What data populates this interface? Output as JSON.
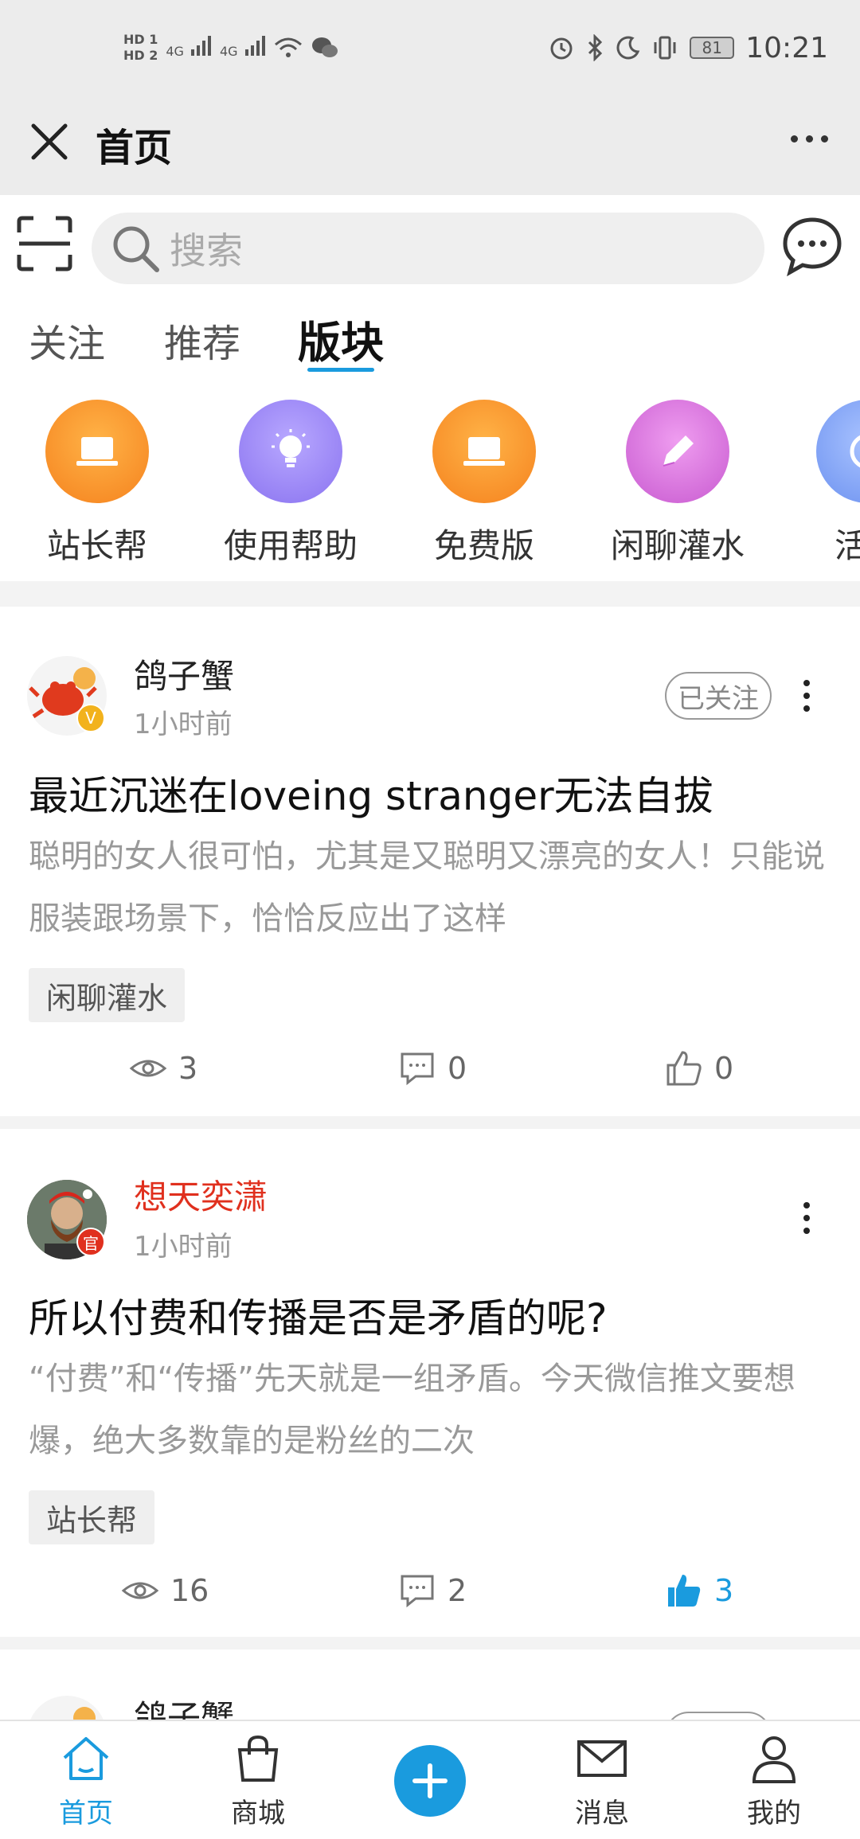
{
  "status": {
    "time": "10:21",
    "battery": "81",
    "network_left": [
      "HD 1",
      "HD 2",
      "4G",
      "4G"
    ]
  },
  "titlebar": {
    "title": "首页"
  },
  "search": {
    "placeholder": "搜索"
  },
  "tabs": [
    {
      "label": "关注"
    },
    {
      "label": "推荐"
    },
    {
      "label": "版块",
      "active": true
    }
  ],
  "categories": [
    {
      "label": "站长帮",
      "color": "#f5921e",
      "icon": "laptop-icon"
    },
    {
      "label": "使用帮助",
      "color": "#9b8cf0",
      "icon": "lightbulb-icon"
    },
    {
      "label": "免费版",
      "color": "#f5921e",
      "icon": "laptop-icon"
    },
    {
      "label": "闲聊灌水",
      "color": "#d76ad8",
      "icon": "pencil-icon"
    },
    {
      "label": "活动",
      "color": "#7aa0f5",
      "icon": "clock-icon"
    }
  ],
  "posts": [
    {
      "author": "鸽子蟹",
      "author_color": "#222222",
      "time": "1小时前",
      "follow": "已关注",
      "title": "最近沉迷在loveing stranger无法自拔",
      "excerpt": "聪明的女人很可怕，尤其是又聪明又漂亮的女人！只能说服装跟场景下，恰恰反应出了这样",
      "tag": "闲聊灌水",
      "views": "3",
      "comments": "0",
      "likes": "0",
      "liked": false,
      "badge": "V"
    },
    {
      "author": "想天奕潇",
      "author_color": "#e0301e",
      "time": "1小时前",
      "follow": "",
      "title": "所以付费和传播是否是矛盾的呢?",
      "excerpt": "“付费”和“传播”先天就是一组矛盾。今天微信推文要想爆，绝大多数靠的是粉丝的二次",
      "tag": "站长帮",
      "views": "16",
      "comments": "2",
      "likes": "3",
      "liked": true,
      "badge": "官"
    },
    {
      "author": "鸽子蟹",
      "author_color": "#222222"
    }
  ],
  "bottom_nav": [
    {
      "label": "首页",
      "active": true
    },
    {
      "label": "商城"
    },
    {
      "label": ""
    },
    {
      "label": "消息"
    },
    {
      "label": "我的"
    }
  ],
  "colors": {
    "accent": "#1a9bde",
    "official_red": "#e0301e"
  }
}
